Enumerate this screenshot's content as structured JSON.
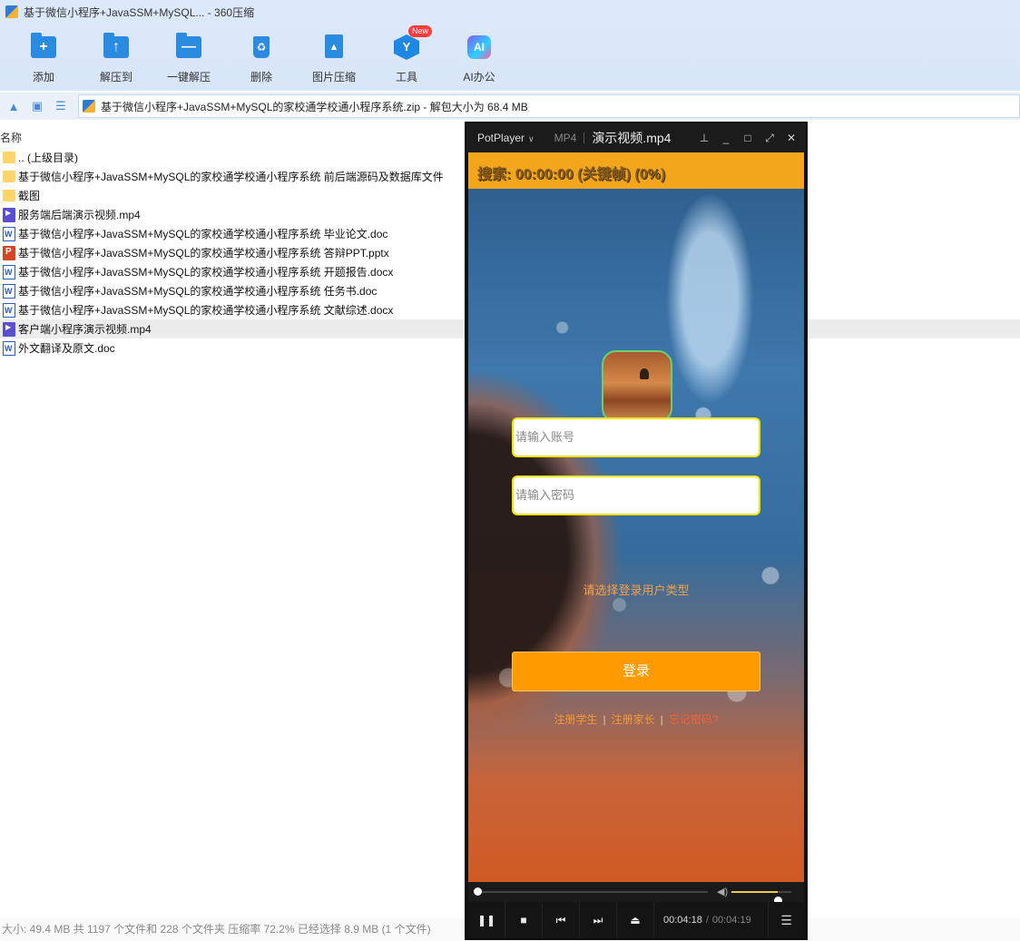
{
  "window": {
    "title": "基于微信小程序+JavaSSM+MySQL... - 360压缩"
  },
  "toolbar": {
    "items": [
      {
        "label": "添加",
        "icon": "add-icon"
      },
      {
        "label": "解压到",
        "icon": "extract-to-icon"
      },
      {
        "label": "一键解压",
        "icon": "one-click-extract-icon"
      },
      {
        "label": "删除",
        "icon": "delete-icon"
      },
      {
        "label": "图片压缩",
        "icon": "image-compress-icon"
      },
      {
        "label": "工具",
        "icon": "tools-icon",
        "badge": "New"
      },
      {
        "label": "AI办公",
        "icon": "ai-office-icon",
        "icon_text": "AI"
      }
    ]
  },
  "address": {
    "path": "基于微信小程序+JavaSSM+MySQL的家校通学校通小程序系统.zip - 解包大小为 68.4 MB"
  },
  "columns": {
    "name": "名称"
  },
  "files": [
    {
      "name": ".. (上级目录)",
      "type": "folder"
    },
    {
      "name": "基于微信小程序+JavaSSM+MySQL的家校通学校通小程序系统 前后端源码及数据库文件",
      "type": "folder"
    },
    {
      "name": "截图",
      "type": "folder"
    },
    {
      "name": "服务端后端演示视频.mp4",
      "type": "mp4"
    },
    {
      "name": "基于微信小程序+JavaSSM+MySQL的家校通学校通小程序系统 毕业论文.doc",
      "type": "doc"
    },
    {
      "name": "基于微信小程序+JavaSSM+MySQL的家校通学校通小程序系统 答辩PPT.pptx",
      "type": "ppt"
    },
    {
      "name": "基于微信小程序+JavaSSM+MySQL的家校通学校通小程序系统 开题报告.docx",
      "type": "doc"
    },
    {
      "name": "基于微信小程序+JavaSSM+MySQL的家校通学校通小程序系统 任务书.doc",
      "type": "doc"
    },
    {
      "name": "基于微信小程序+JavaSSM+MySQL的家校通学校通小程序系统 文献综述.docx",
      "type": "doc"
    },
    {
      "name": "客户端小程序演示视频.mp4",
      "type": "mp4",
      "selected": true
    },
    {
      "name": "外文翻译及原文.doc",
      "type": "doc"
    }
  ],
  "status": {
    "text": "大小: 49.4 MB 共 1197 个文件和 228 个文件夹 压缩率 72.2% 已经选择 8.9 MB (1 个文件)"
  },
  "player": {
    "brand": "PotPlayer",
    "format": "MP4",
    "filename": "演示视频.mp4",
    "search_overlay": "搜索: 00:00:00 (关键帧) (0%)",
    "app": {
      "account_placeholder": "请输入账号",
      "password_placeholder": "请输入密码",
      "user_type_prompt": "请选择登录用户类型",
      "login_button": "登录",
      "register_student": "注册学生",
      "register_parent": "注册家长",
      "forgot_password": "忘记密码?",
      "link_divider": "|"
    },
    "time_current": "00:04:18",
    "time_separator": "/",
    "time_total": "00:04:19",
    "progress_fraction": 0.0,
    "volume_fraction": 0.78
  }
}
